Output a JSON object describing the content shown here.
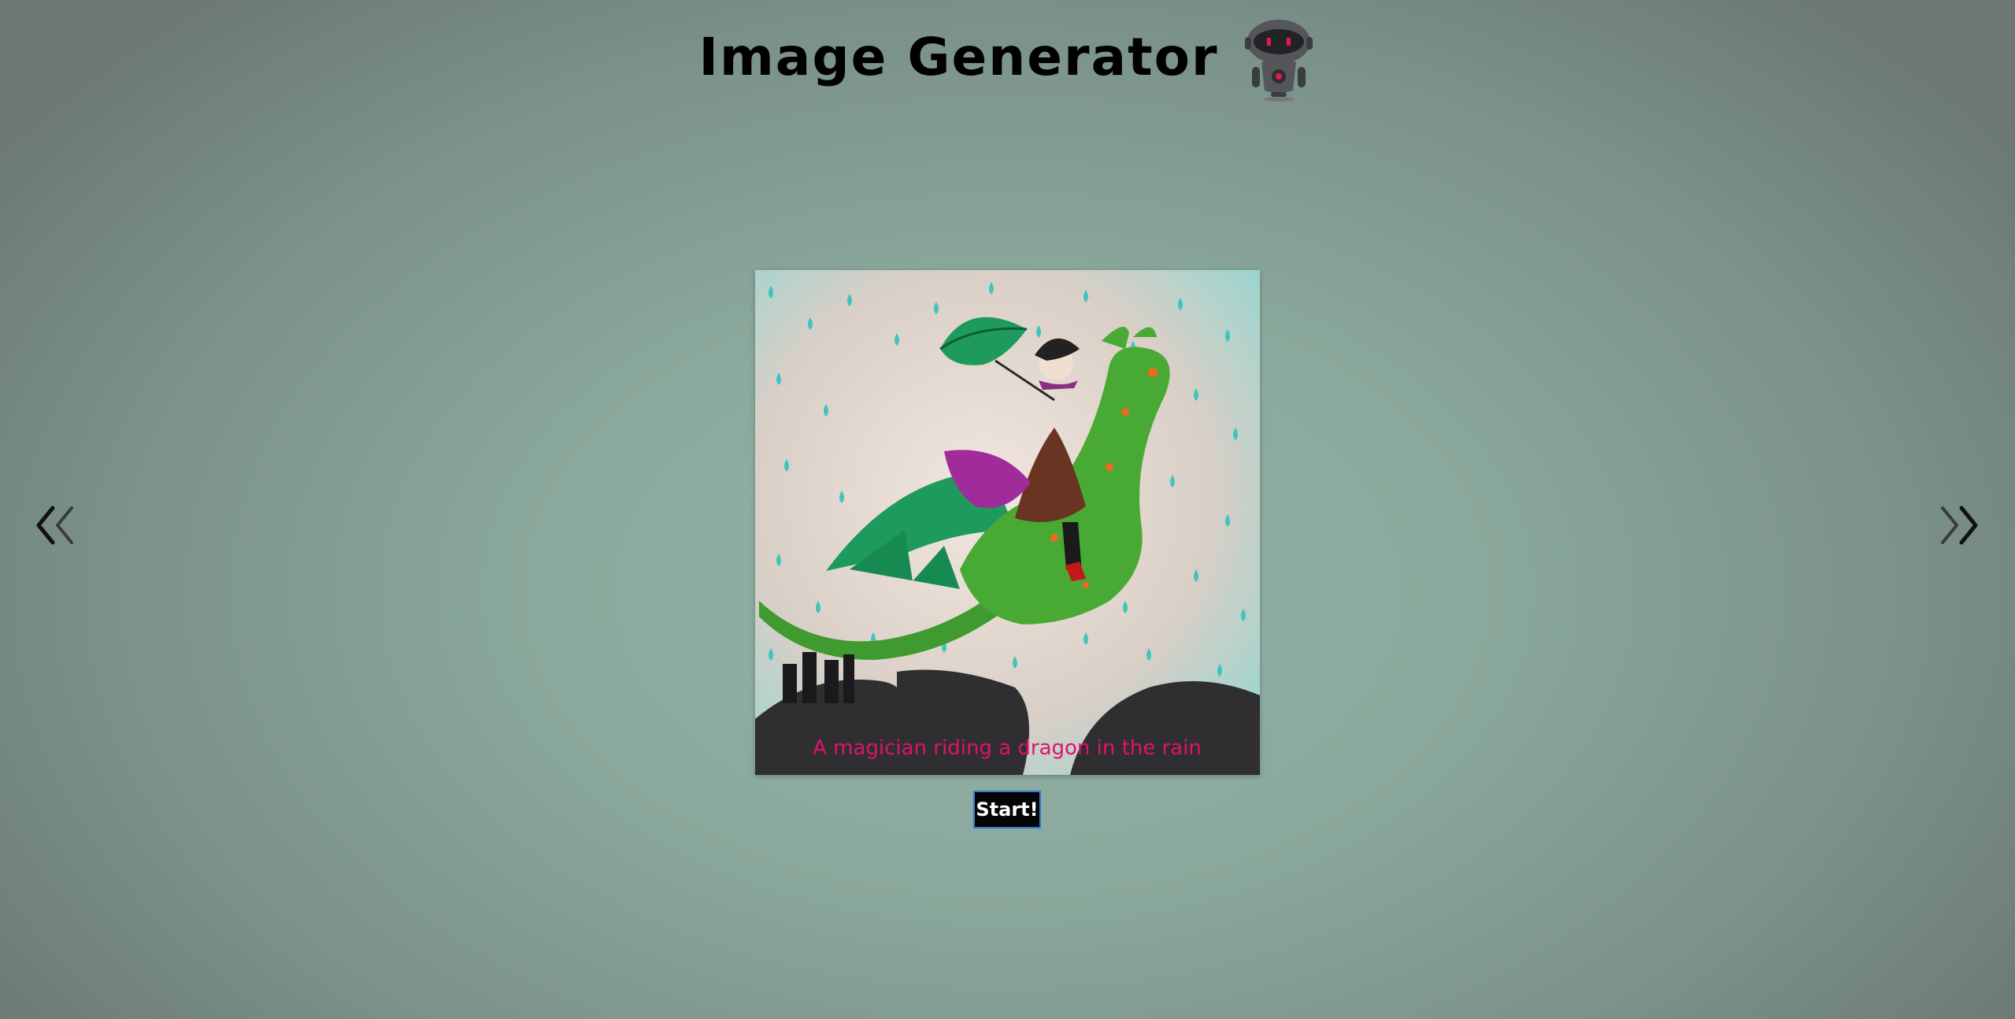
{
  "header": {
    "title": "Image Generator",
    "logo_icon": "robot-icon"
  },
  "navigation": {
    "prev_icon": "double-chevron-left-icon",
    "next_icon": "double-chevron-right-icon"
  },
  "gallery": {
    "image_subject": "magician-riding-dragon-illustration",
    "caption": "A magician riding a dragon in the rain"
  },
  "controls": {
    "start_label": "Start!"
  },
  "colors": {
    "background_center": "#93b2a6",
    "background_edge": "#6b7773",
    "caption": "#e0116a",
    "button_bg": "#050505",
    "button_border": "#2f7bd6",
    "dragon": "#3f9b2f",
    "rain": "#33c7bf"
  }
}
